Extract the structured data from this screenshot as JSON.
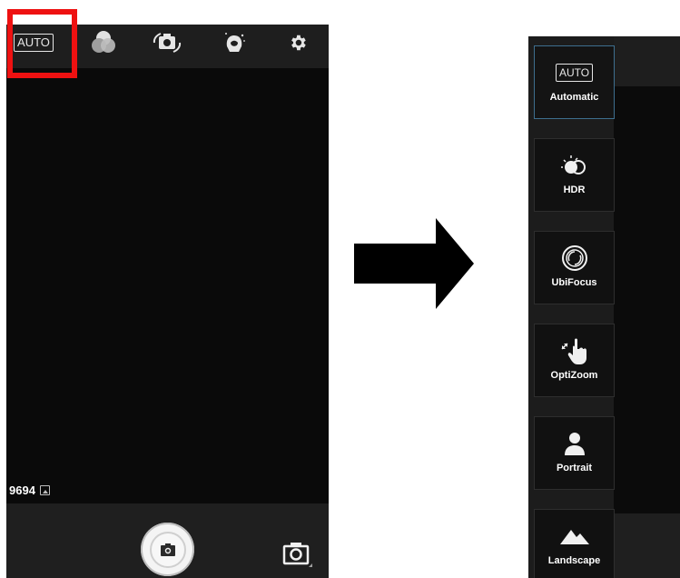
{
  "left_screen": {
    "top_bar": {
      "auto_label": "AUTO",
      "icons": [
        "scene-mode-icon",
        "color-filter-icon",
        "switch-camera-icon",
        "beauty-icon",
        "settings-icon"
      ]
    },
    "photo_counter": "9694",
    "highlight_color": "#ee1111"
  },
  "right_screen": {
    "scene_modes": [
      {
        "label": "Automatic",
        "icon": "auto-icon",
        "icon_text": "AUTO",
        "selected": true
      },
      {
        "label": "HDR",
        "icon": "hdr-icon"
      },
      {
        "label": "UbiFocus",
        "icon": "ubifocus-icon"
      },
      {
        "label": "OptiZoom",
        "icon": "optizoom-icon"
      },
      {
        "label": "Portrait",
        "icon": "portrait-icon"
      },
      {
        "label": "Landscape",
        "icon": "landscape-icon"
      }
    ],
    "selected_border_color": "#3e6f8f"
  }
}
